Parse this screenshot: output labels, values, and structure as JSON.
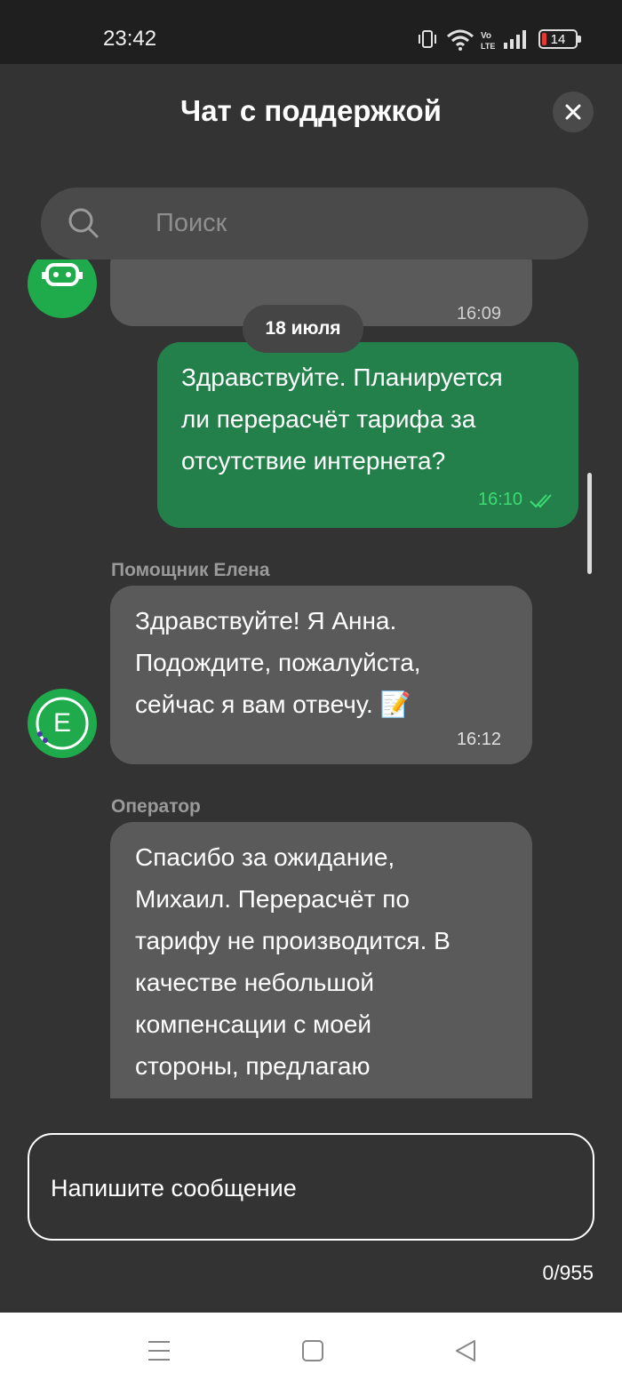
{
  "status_bar": {
    "time": "23:42",
    "battery": "14"
  },
  "header": {
    "title": "Чат с поддержкой"
  },
  "search": {
    "placeholder": "Поиск"
  },
  "messages": [
    {
      "time": "16:09"
    },
    {
      "date_separator": "18 июля"
    },
    {
      "text_lines": [
        "Здравствуйте. Планируется",
        "ли перерасчёт тарифа за",
        "отсутствие интернета?"
      ],
      "time": "16:10"
    },
    {
      "sender": "Помощник Елена",
      "text_lines": [
        "Здравствуйте! Я Анна.",
        "Подождите, пожалуйста,",
        "сейчас я вам отвечу. 📝"
      ],
      "time": "16:12",
      "avatar_letter": "E"
    },
    {
      "sender": "Оператор",
      "text_lines": [
        "Спасибо за ожидание,",
        "Михаил. Перерасчёт по",
        "тарифу не производится. В",
        "качестве небольшой",
        "компенсации с моей",
        "стороны, предлагаю"
      ]
    }
  ],
  "composer": {
    "placeholder": "Напишите сообщение",
    "counter": "0/955"
  },
  "colors": {
    "outgoing": "#23804a",
    "incoming": "#5a5a5a",
    "avatar": "#1fab4b",
    "background": "#333333"
  },
  "icons": [
    "signal-icon",
    "wifi-icon",
    "volte-icon",
    "battery-icon",
    "close-icon",
    "search-icon",
    "read-receipt-icon",
    "menu-icon",
    "home-icon",
    "back-icon"
  ]
}
